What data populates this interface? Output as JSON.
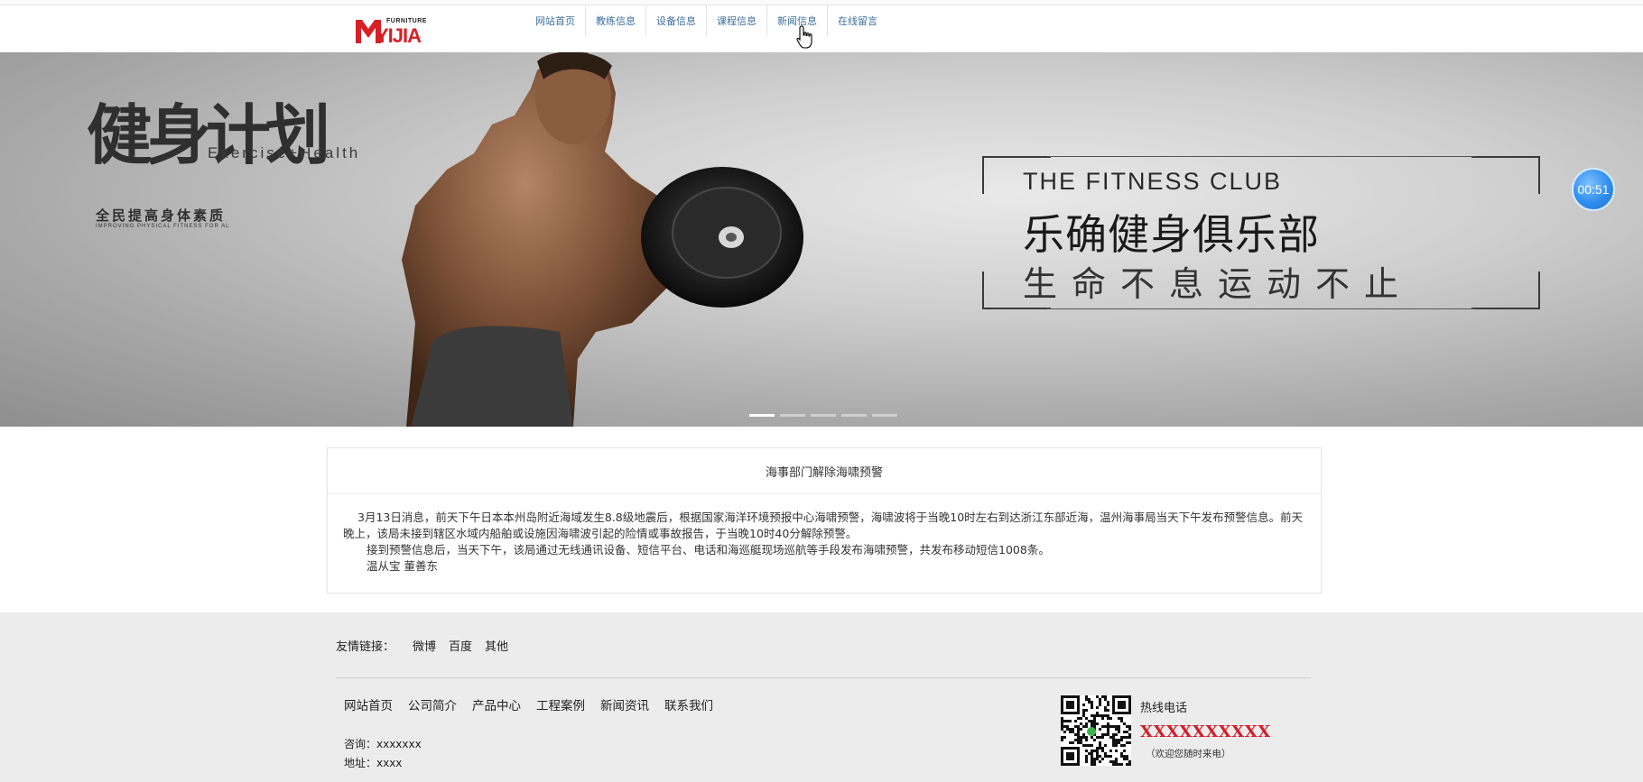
{
  "header": {
    "logo_small": "FURNITURE",
    "logo_big": "YIJIA",
    "nav": [
      {
        "label": "网站首页"
      },
      {
        "label": "教练信息"
      },
      {
        "label": "设备信息"
      },
      {
        "label": "课程信息"
      },
      {
        "label": "新闻信息"
      },
      {
        "label": "在线留言"
      }
    ]
  },
  "banner": {
    "slogan_big": "健身计划",
    "slogan_en": "Exercise+Health",
    "slogan_cn": "全民提高身体素质",
    "slogan_tiny": "IMPROVING PHYSICAL FITNESS FOR AL",
    "club_en": "THE FITNESS CLUB",
    "club_cn": "乐确健身俱乐部",
    "club_motto": "生命不息运动不止",
    "timer": "00:51",
    "slide_count": 5,
    "active_slide": 1
  },
  "news": {
    "title": "海事部门解除海啸预警",
    "paragraphs": [
      "3月13日消息，前天下午日本本州岛附近海域发生8.8级地震后，根据国家海洋环境预报中心海啸预警，海啸波将于当晚10时左右到达浙江东部近海，温州海事局当天下午发布预警信息。前天晚上，该局未接到辖区水域内船舶或设施因海啸波引起的险情或事故报告，于当晚10时40分解除预警。",
      "接到预警信息后，当天下午，该局通过无线通讯设备、短信平台、电话和海巡艇现场巡航等手段发布海啸预警，共发布移动短信1008条。",
      "温从宝 董善东"
    ]
  },
  "footer": {
    "friend_label": "友情链接：",
    "friend_links": [
      "微博",
      "百度",
      "其他"
    ],
    "nav": [
      "网站首页",
      "公司简介",
      "产品中心",
      "工程案例",
      "新闻资讯",
      "联系我们"
    ],
    "consult": "咨询：xxxxxxx",
    "address": "地址：xxxx",
    "hotline_label": "热线电话",
    "hotline_number": "XXXXXXXXXX",
    "hotline_welcome": "（欢迎您随时来电）"
  },
  "colors": {
    "nav_text": "#3d6f9e",
    "brand_red": "#d91f26",
    "hotline_red": "#d0202b",
    "footer_bg": "#ececec",
    "timer_blue": "#2f8ef0"
  }
}
